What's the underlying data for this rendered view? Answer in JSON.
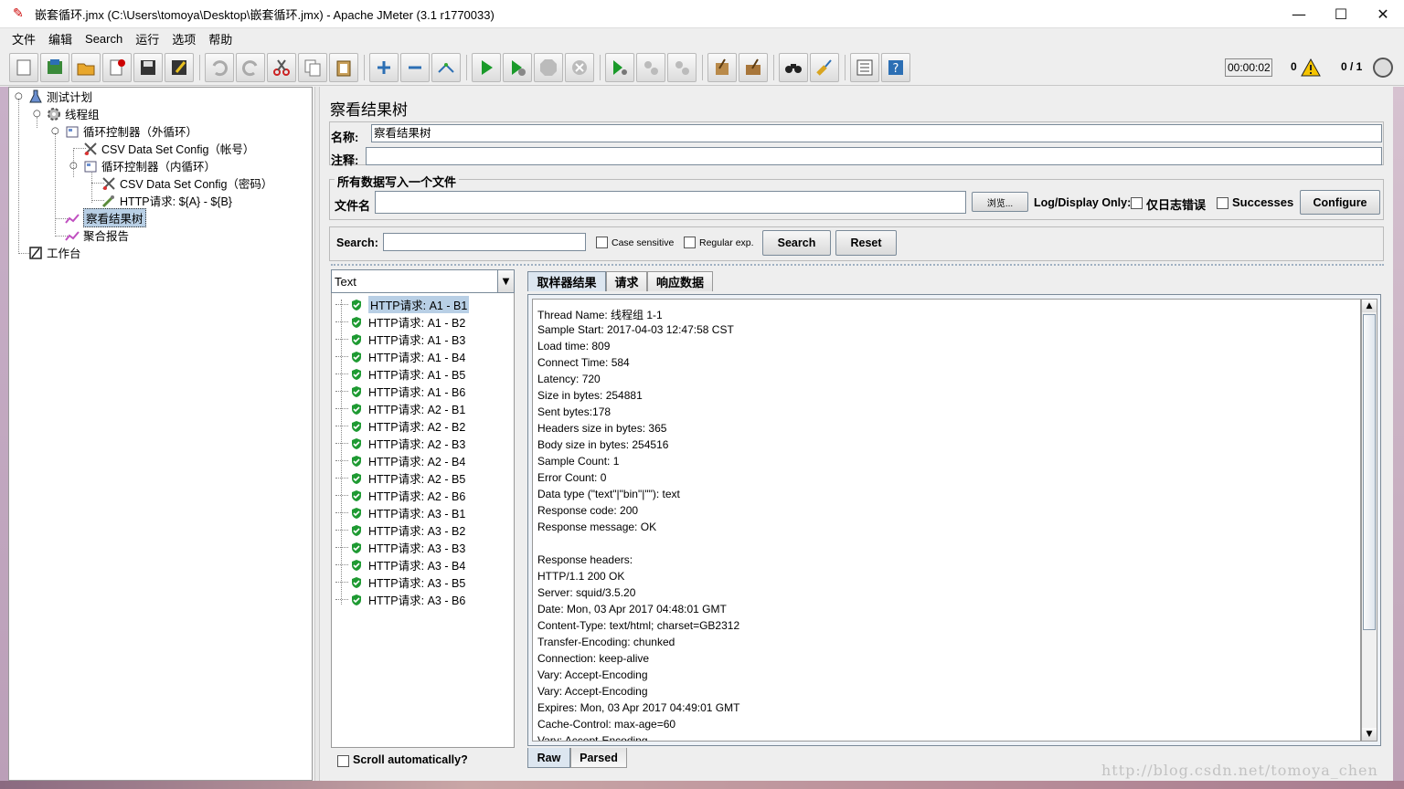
{
  "window": {
    "title": "嵌套循环.jmx (C:\\Users\\tomoya\\Desktop\\嵌套循环.jmx) - Apache JMeter (3.1 r1770033)",
    "minimize": "—",
    "maximize": "☐",
    "close": "✕"
  },
  "menu": [
    "文件",
    "编辑",
    "Search",
    "运行",
    "选项",
    "帮助"
  ],
  "status": {
    "elapsed": "00:00:02",
    "errors": "0",
    "threads": "0 / 1"
  },
  "tree": [
    {
      "label": "测试计划",
      "icon": "flask-icon"
    },
    {
      "label": "线程组",
      "icon": "gear-icon"
    },
    {
      "label": "循环控制器（外循环）",
      "icon": "controller-icon"
    },
    {
      "label": "CSV Data Set Config（帐号）",
      "icon": "scissors-icon"
    },
    {
      "label": "循环控制器（内循环）",
      "icon": "controller-icon"
    },
    {
      "label": "CSV Data Set Config（密码）",
      "icon": "scissors-icon"
    },
    {
      "label": "HTTP请求: ${A} - ${B}",
      "icon": "pipette-icon"
    },
    {
      "label": "察看结果树",
      "icon": "chart-icon"
    },
    {
      "label": "聚合报告",
      "icon": "chart-icon"
    },
    {
      "label": "工作台",
      "icon": "workbench-icon"
    }
  ],
  "main": {
    "title": "察看结果树",
    "name_label": "名称:",
    "name_value": "察看结果树",
    "comment_label": "注释:",
    "comment_value": "",
    "file_group": "所有数据写入一个文件",
    "filename_label": "文件名",
    "filename_value": "",
    "browse": "浏览...",
    "log_display": "Log/Display Only:",
    "errors_only": "仅日志错误",
    "successes": "Successes",
    "configure": "Configure",
    "search_label": "Search:",
    "search_value": "",
    "case_sensitive": "Case sensitive",
    "regular_exp": "Regular exp.",
    "search_button": "Search",
    "reset_button": "Reset",
    "renderer": "Text",
    "scroll_auto": "Scroll automatically?"
  },
  "results": [
    "HTTP请求: A1 - B1",
    "HTTP请求: A1 - B2",
    "HTTP请求: A1 - B3",
    "HTTP请求: A1 - B4",
    "HTTP请求: A1 - B5",
    "HTTP请求: A1 - B6",
    "HTTP请求: A2 - B1",
    "HTTP请求: A2 - B2",
    "HTTP请求: A2 - B3",
    "HTTP请求: A2 - B4",
    "HTTP请求: A2 - B5",
    "HTTP请求: A2 - B6",
    "HTTP请求: A3 - B1",
    "HTTP请求: A3 - B2",
    "HTTP请求: A3 - B3",
    "HTTP请求: A3 - B4",
    "HTTP请求: A3 - B5",
    "HTTP请求: A3 - B6"
  ],
  "tabs": [
    "取样器结果",
    "请求",
    "响应数据"
  ],
  "bottom_tabs": [
    "Raw",
    "Parsed"
  ],
  "sampler_result": [
    "Thread Name: 线程组 1-1",
    "Sample Start: 2017-04-03 12:47:58 CST",
    "Load time: 809",
    "Connect Time: 584",
    "Latency: 720",
    "Size in bytes: 254881",
    "Sent bytes:178",
    "Headers size in bytes: 365",
    "Body size in bytes: 254516",
    "Sample Count: 1",
    "Error Count: 0",
    "Data type (\"text\"|\"bin\"|\"\"): text",
    "Response code: 200",
    "Response message: OK",
    "",
    "Response headers:",
    "HTTP/1.1 200 OK",
    "Server: squid/3.5.20",
    "Date: Mon, 03 Apr 2017 04:48:01 GMT",
    "Content-Type: text/html; charset=GB2312",
    "Transfer-Encoding: chunked",
    "Connection: keep-alive",
    "Vary: Accept-Encoding",
    "Vary: Accept-Encoding",
    "Expires: Mon, 03 Apr 2017 04:49:01 GMT",
    "Cache-Control: max-age=60",
    "Vary: Accept-Encoding"
  ],
  "watermark": "http://blog.csdn.net/tomoya_chen"
}
